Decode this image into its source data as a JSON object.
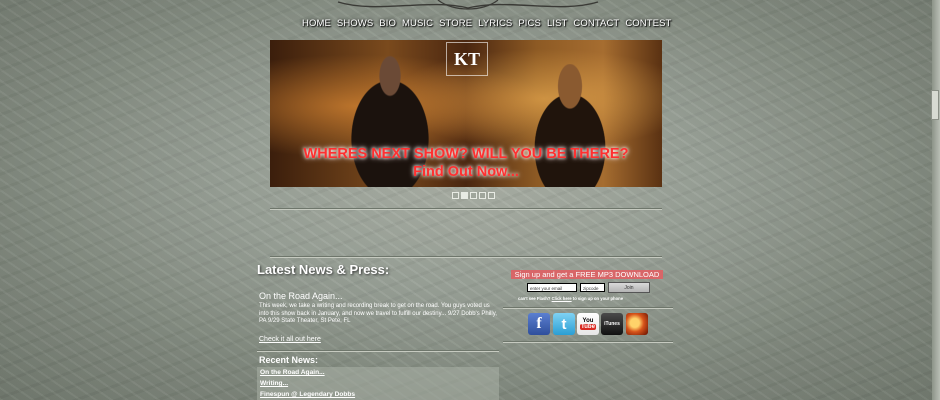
{
  "nav": {
    "items": [
      "HOME",
      "SHOWS",
      "BIO",
      "MUSIC",
      "STORE",
      "LYRICS",
      "PICS",
      "LIST",
      "CONTACT",
      "CONTEST"
    ]
  },
  "banner": {
    "logo_text": "KT",
    "line1": "WHERES NEXT SHOW? WILL YOU BE THERE?",
    "line2": "Find Out Now..."
  },
  "slider": {
    "count": 5,
    "active_index": 1
  },
  "news": {
    "heading": "Latest News & Press:",
    "article_title": "On the Road Again...",
    "article_body": "This week, we take a writing and recording break to get on the road. You guys voted us into this show back in January, and now we travel to fulfill our destiny... 9/27 Dobb's Philly, PA 9/29 State Theater, St Pete, FL",
    "check_link": "Check it all out here",
    "recent_heading": "Recent News:",
    "recent_items": [
      "On the Road Again...",
      "Writing...",
      "Finespun @ Legendary Dobbs"
    ]
  },
  "signup": {
    "banner_text": "Sign up and get a FREE MP3 DOWNLOAD",
    "email_value": "enter your email",
    "zip_value": "zipcode",
    "join_label": "Join",
    "noflash_prefix": "can't see Flash?",
    "noflash_link": "Click here",
    "noflash_suffix": "to sign up on your phone"
  },
  "social": {
    "facebook_glyph": "f",
    "twitter_glyph": "t",
    "youtube_you": "You",
    "youtube_tube": "Tube",
    "itunes_label": "iTunes"
  },
  "colors": {
    "signup_bar": "#d86668",
    "banner_text": "#ff3030"
  }
}
